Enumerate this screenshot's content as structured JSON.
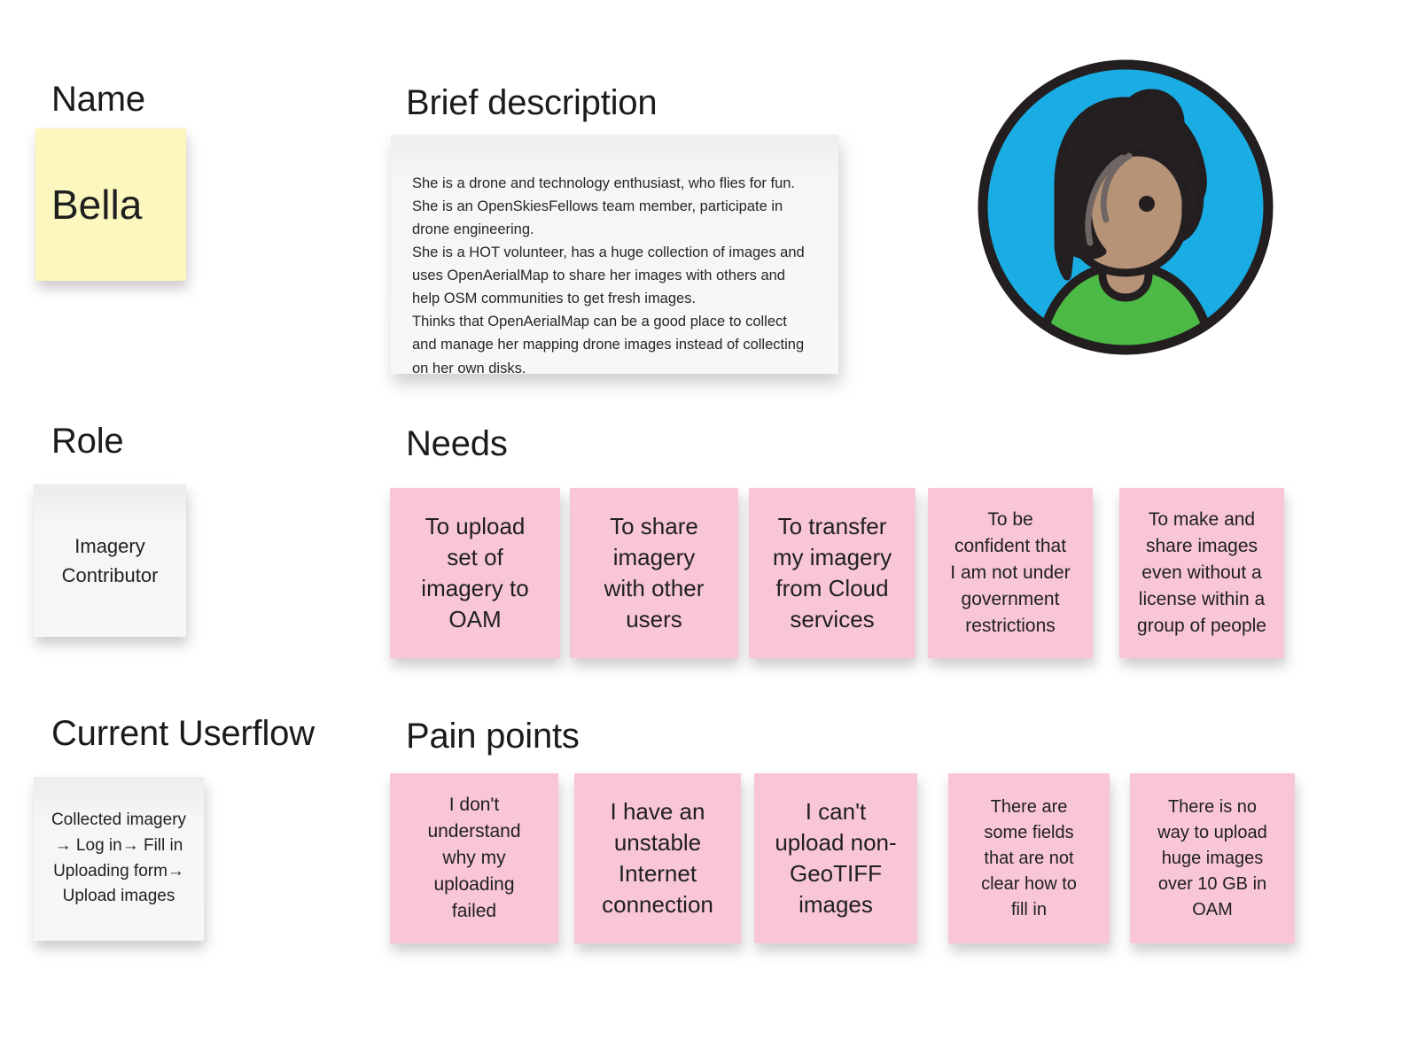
{
  "page": {
    "kind": "user-persona-board",
    "background": "#ffffff"
  },
  "sections": {
    "name": {
      "heading": "Name",
      "note": "Bella",
      "note_color": "#fbf7bf"
    },
    "role": {
      "heading": "Role",
      "note": "Imagery\nContributor",
      "note_color": "#f5f5f7"
    },
    "userflow": {
      "heading": "Current Userflow",
      "note": "Collected imagery\n→ Log in→ Fill in\nUploading form→\nUpload images",
      "note_color": "#f5f5f7"
    },
    "brief": {
      "heading": "Brief description",
      "body": "She is a drone and technology enthusiast, who flies for fun. She is an OpenSkiesFellows team member, participate in drone engineering.\nShe is a HOT volunteer, has a huge collection of images and uses OpenAerialMap to share her images with others and help OSM communities to get fresh images.\nThinks that OpenAerialMap can be a good place to collect and manage her mapping drone images  instead of collecting on her own disks.",
      "card_color": "#f6f6f7"
    },
    "needs": {
      "heading": "Needs",
      "note_color": "#f9c6d5",
      "notes": [
        {
          "text": "To upload\nset of\nimagery to\nOAM",
          "size": "large"
        },
        {
          "text": "To share\nimagery\nwith other\nusers",
          "size": "large"
        },
        {
          "text": "To transfer\nmy imagery\nfrom Cloud\nservices",
          "size": "large"
        },
        {
          "text": "To be\nconfident that\nI am not under\ngovernment\nrestrictions",
          "size": "small"
        },
        {
          "text": "To make and\nshare images\neven without a\nlicense within a\ngroup of people",
          "size": "small"
        }
      ]
    },
    "pain_points": {
      "heading": "Pain points",
      "note_color": "#f9c6d5",
      "notes": [
        {
          "text": "I don't\nunderstand\nwhy my\nuploading\nfailed",
          "size": "small"
        },
        {
          "text": "I have an\nunstable\nInternet\nconnection",
          "size": "large"
        },
        {
          "text": "I can't\nupload non-\nGeoTIFF\nimages",
          "size": "large"
        },
        {
          "text": "There are\nsome fields\nthat are not\nclear how to\nfill in",
          "size": "small"
        },
        {
          "text": "There is no\nway to upload\nhuge images\nover 10 GB in\nOAM",
          "size": "small"
        }
      ]
    },
    "avatar": {
      "name": "persona-avatar-illustration",
      "colors": {
        "background_circle": "#19ade4",
        "outline": "#231f20",
        "hair": "#262020",
        "hair_highlight": "#6f6563",
        "skin": "#b69376",
        "shirt": "#4cb944",
        "eye": "#231f20"
      }
    }
  }
}
